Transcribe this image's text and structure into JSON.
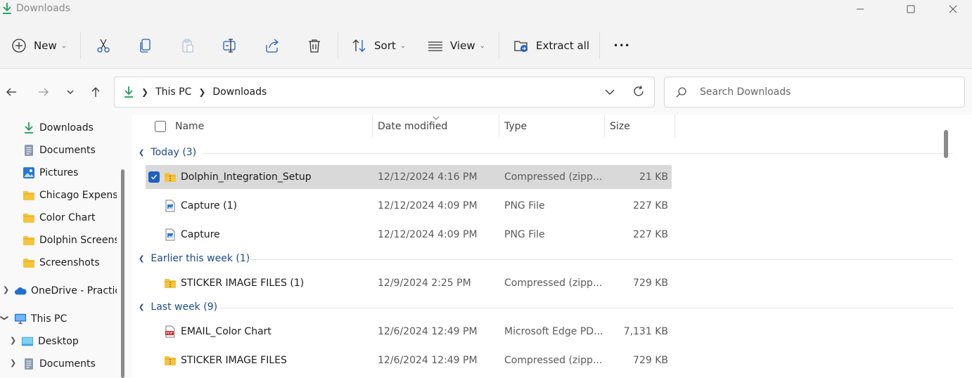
{
  "window": {
    "title": "Downloads"
  },
  "toolbar": {
    "new_label": "New",
    "sort_label": "Sort",
    "view_label": "View",
    "extract_label": "Extract all",
    "more_label": "•••"
  },
  "address": {
    "crumbs": [
      "This PC",
      "Downloads"
    ]
  },
  "search": {
    "placeholder": "Search Downloads"
  },
  "sidebar": {
    "items": [
      {
        "label": "Downloads",
        "icon": "download-icon",
        "pinned": true
      },
      {
        "label": "Documents",
        "icon": "document-icon",
        "pinned": true
      },
      {
        "label": "Pictures",
        "icon": "pictures-icon",
        "pinned": true
      },
      {
        "label": "Chicago Expense",
        "icon": "folder-icon"
      },
      {
        "label": "Color Chart",
        "icon": "folder-icon"
      },
      {
        "label": "Dolphin Screens",
        "icon": "folder-icon"
      },
      {
        "label": "Screenshots",
        "icon": "folder-icon"
      },
      {
        "label": "OneDrive - Practic",
        "icon": "cloud-icon"
      },
      {
        "label": "This PC",
        "icon": "computer-icon"
      },
      {
        "label": "Desktop",
        "icon": "desktop-icon"
      },
      {
        "label": "Documents",
        "icon": "document-icon"
      }
    ]
  },
  "columns": {
    "name": "Name",
    "date": "Date modified",
    "type": "Type",
    "size": "Size"
  },
  "groups": [
    {
      "label": "Today (3)",
      "files": [
        {
          "name": "Dolphin_Integration_Setup",
          "date": "12/12/2024 4:16 PM",
          "type": "Compressed (zipp...",
          "size": "21 KB",
          "icon": "zip-folder-icon",
          "selected": true
        },
        {
          "name": "Capture (1)",
          "date": "12/12/2024 4:09 PM",
          "type": "PNG File",
          "size": "227 KB",
          "icon": "image-file-icon"
        },
        {
          "name": "Capture",
          "date": "12/12/2024 4:09 PM",
          "type": "PNG File",
          "size": "227 KB",
          "icon": "image-file-icon"
        }
      ]
    },
    {
      "label": "Earlier this week (1)",
      "files": [
        {
          "name": "STICKER IMAGE FILES (1)",
          "date": "12/9/2024 2:25 PM",
          "type": "Compressed (zipp...",
          "size": "729 KB",
          "icon": "zip-folder-icon"
        }
      ]
    },
    {
      "label": "Last week (9)",
      "files": [
        {
          "name": "EMAIL_Color Chart",
          "date": "12/6/2024 12:49 PM",
          "type": "Microsoft Edge PD...",
          "size": "7,131 KB",
          "icon": "pdf-file-icon"
        },
        {
          "name": "STICKER IMAGE FILES",
          "date": "12/6/2024 12:49 PM",
          "type": "Compressed (zipp...",
          "size": "729 KB",
          "icon": "zip-folder-icon"
        }
      ]
    }
  ],
  "colors": {
    "accent": "#1f5fbf",
    "group_text": "#1a4a8a",
    "selection": "#d9d9d9",
    "download_green": "#1e9e5a",
    "folder_yellow": "#f6c33c"
  }
}
